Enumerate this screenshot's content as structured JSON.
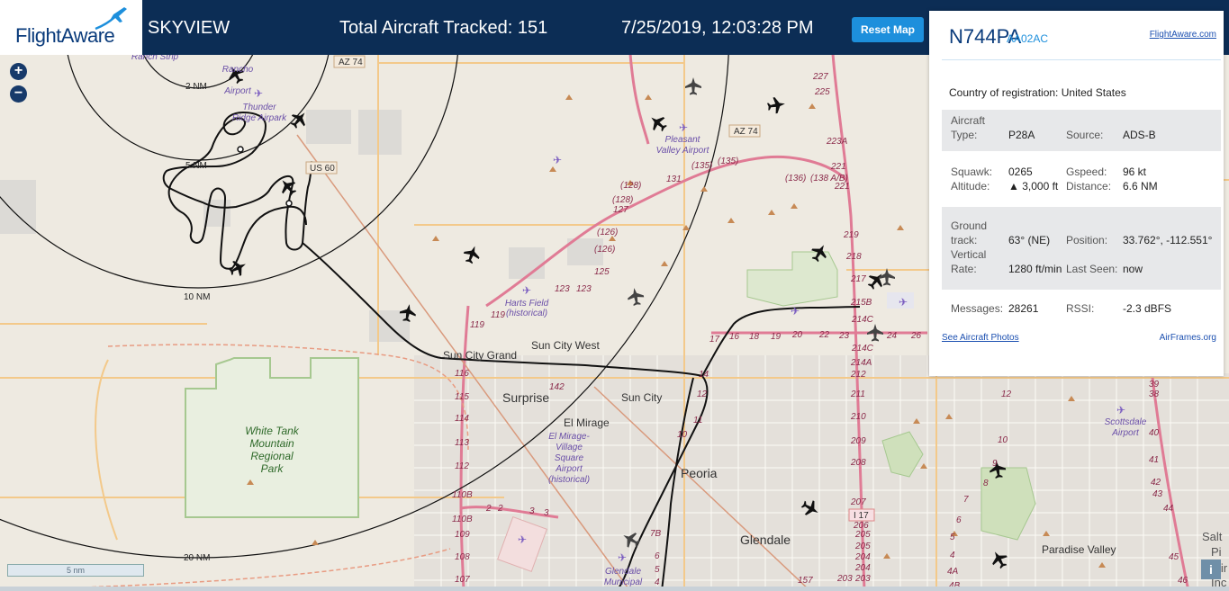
{
  "header": {
    "logo": "FlightAware",
    "brand": "SKYVIEW",
    "total_aircraft": "Total Aircraft Tracked: 151",
    "datetime": "7/25/2019, 12:03:28 PM",
    "reset_label": "Reset Map"
  },
  "zoom": {
    "in": "+",
    "out": "−"
  },
  "panel": {
    "ident": "N744PA",
    "hex": "AA02AC",
    "fa_link": "FlightAware.com",
    "country_label": "Country of registration:",
    "country": "United States",
    "aircraft_type_label": "Aircraft Type:",
    "aircraft_type": "P28A",
    "source_label": "Source:",
    "source": "ADS-B",
    "squawk_label": "Squawk:",
    "squawk": "0265",
    "gspeed_label": "Gspeed:",
    "gspeed": "96 kt",
    "altitude_label": "Altitude:",
    "altitude": "▲ 3,000 ft",
    "distance_label": "Distance:",
    "distance": "6.6 NM",
    "track_label": "Ground track:",
    "track": "63° (NE)",
    "position_label": "Position:",
    "position": "33.762°, -112.551°",
    "vrate_label": "Vertical Rate:",
    "vrate": "1280 ft/min",
    "lastseen_label": "Last Seen:",
    "lastseen": "now",
    "messages_label": "Messages:",
    "messages": "28261",
    "rssi_label": "RSSI:",
    "rssi": "-2.3 dBFS",
    "photos_link": "See Aircraft Photos",
    "airframes_link": "AirFrames.org"
  },
  "scale": "5 nm",
  "info": "i",
  "map": {
    "rings": [
      "2 NM",
      "5 NM",
      "10 NM",
      "20 NM"
    ],
    "places": [
      "Sun City Grand",
      "Sun City West",
      "Surprise",
      "Sun City",
      "El Mirage",
      "Peoria",
      "Glendale",
      "Paradise Valley",
      "Salt",
      "Pi",
      "Mir",
      "Inc"
    ],
    "parks": [
      "White Tank",
      "Mountain",
      "Regional",
      "Park"
    ],
    "airports": [
      "Pleasant",
      "Valley Airport",
      "Harts Field",
      "(historical)",
      "El Mirage-",
      "Village",
      "Square",
      "Airport",
      "(historical)",
      "Scottsdale",
      "Airport",
      "Thunder",
      "Ridge Airpark",
      "Rancho",
      "Airport",
      "Ranch Strip",
      "Glendale",
      "Municipal"
    ],
    "highways": [
      "AZ 74",
      "AZ 74",
      "US 60",
      "I 17"
    ],
    "routes": [
      "(135)",
      "(135)",
      "(136)",
      "(138 A/B)",
      "(128)",
      "(128)",
      "(126)",
      "(126)",
      "131",
      "127",
      "125",
      "123",
      "123",
      "119",
      "119",
      "142",
      "116",
      "115",
      "114",
      "113",
      "112",
      "110B",
      "110B",
      "109",
      "108",
      "107",
      "17",
      "16",
      "18",
      "19",
      "20",
      "22",
      "23",
      "24",
      "26",
      "14",
      "12",
      "11",
      "10",
      "2",
      "2",
      "3",
      "3",
      "7B",
      "6",
      "5",
      "4",
      "227",
      "225",
      "223A",
      "221",
      "221",
      "219",
      "218",
      "217",
      "215B",
      "214C",
      "214C",
      "214A",
      "212",
      "211",
      "210",
      "209",
      "208",
      "207",
      "206",
      "205",
      "205",
      "204",
      "204",
      "203",
      "203",
      "157",
      "12",
      "10",
      "9",
      "8",
      "7",
      "6",
      "5",
      "4",
      "4A",
      "4B",
      "39",
      "38",
      "40",
      "41",
      "42",
      "43",
      "44",
      "45",
      "46"
    ]
  }
}
